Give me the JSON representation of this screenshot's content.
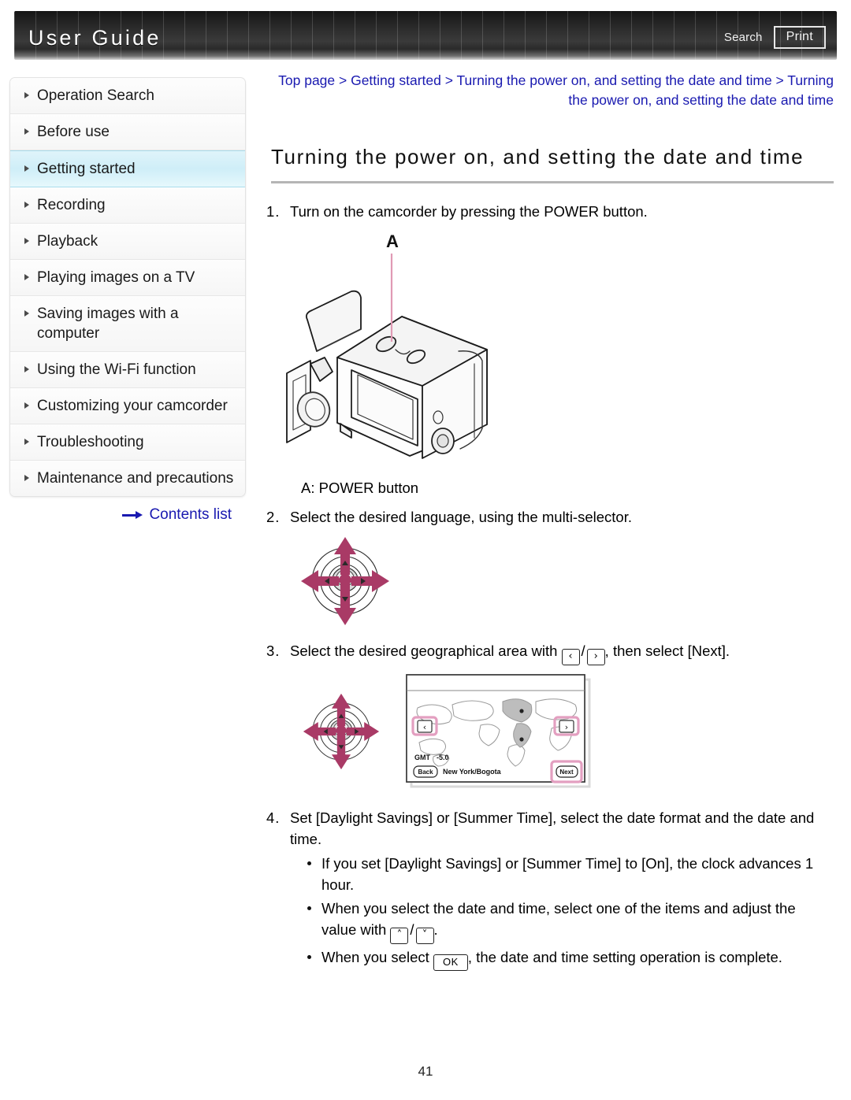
{
  "header": {
    "brand": "User Guide",
    "search_label": "Search",
    "print_label": "Print"
  },
  "sidebar": {
    "items": [
      {
        "label": "Operation Search",
        "active": false
      },
      {
        "label": "Before use",
        "active": false
      },
      {
        "label": "Getting started",
        "active": true
      },
      {
        "label": "Recording",
        "active": false
      },
      {
        "label": "Playback",
        "active": false
      },
      {
        "label": "Playing images on a TV",
        "active": false
      },
      {
        "label": "Saving images with a computer",
        "active": false
      },
      {
        "label": "Using the Wi-Fi function",
        "active": false
      },
      {
        "label": "Customizing your camcorder",
        "active": false
      },
      {
        "label": "Troubleshooting",
        "active": false
      },
      {
        "label": "Maintenance and precautions",
        "active": false
      }
    ],
    "contents_link": "Contents list"
  },
  "main": {
    "breadcrumb": "Top page > Getting started > Turning the power on, and setting the date and time > Turning the power on, and setting the date and time",
    "title": "Turning the power on, and setting the date and time",
    "steps": [
      {
        "num": "1.",
        "text": "Turn on the camcorder by pressing the POWER button."
      },
      {
        "num": "2.",
        "text": "Select the desired language, using the multi-selector."
      },
      {
        "num": "3.",
        "text_before": "Select the desired geographical area with ",
        "text_after": ", then select [Next]."
      },
      {
        "num": "4.",
        "text": "Set [Daylight Savings] or [Summer Time], select the date format and the date and time."
      }
    ],
    "camera_caption": "A: POWER button",
    "camera_callout": "A",
    "bullets": [
      {
        "text": "If you set [Daylight Savings] or [Summer Time] to [On], the clock advances 1 hour."
      },
      {
        "text_before": "When you select the date and time, select one of the items and adjust the value with ",
        "text_after": "."
      },
      {
        "text_before": "When you select ",
        "text_after": ", the date and time setting operation is complete."
      }
    ],
    "icons": {
      "left": "‹",
      "right": "›",
      "up": "˄",
      "down": "˅",
      "ok": "OK",
      "slash": "/"
    },
    "map_screen": {
      "gmt_label": "GMT",
      "gmt_value": "-5.0",
      "back_label": "Back",
      "area_label": "New York/Bogota",
      "next_label": "Next"
    },
    "page_number": "41"
  },
  "colors": {
    "link": "#1919b0",
    "accent_pink": "#a93a66",
    "highlight": "#cfeef8"
  }
}
